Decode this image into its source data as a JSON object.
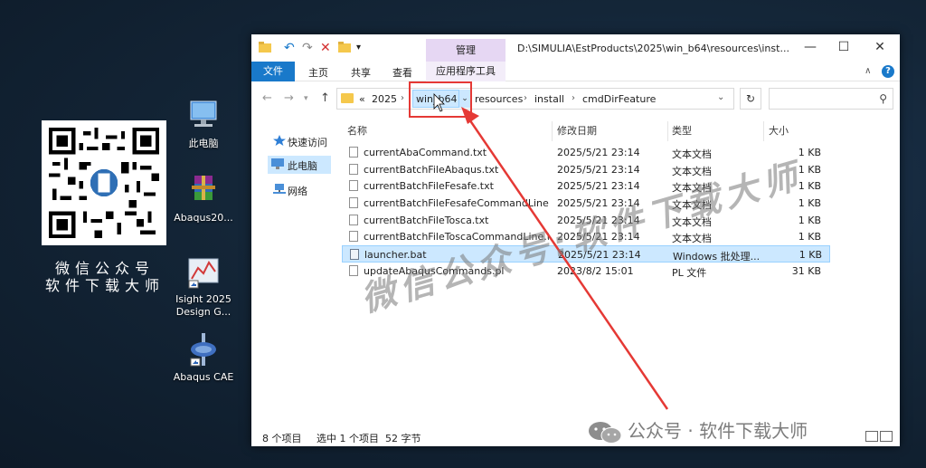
{
  "desktop": {
    "qr_caption_line1": "微信公众号",
    "qr_caption_line2": "软件下载大师",
    "icons": [
      {
        "label": "此电脑"
      },
      {
        "label": "Abaqus20..."
      },
      {
        "label": "Isight 2025 Design G..."
      },
      {
        "label": "Abaqus CAE"
      }
    ]
  },
  "window": {
    "title_path": "D:\\SIMULIA\\EstProducts\\2025\\win_b64\\resources\\inst...",
    "manage_tab": "管理",
    "ribbon_tabs": {
      "file": "文件",
      "home": "主页",
      "share": "共享",
      "view": "查看",
      "app_tools": "应用程序工具"
    },
    "address": {
      "overflow": "«",
      "segments": [
        "2025",
        "win_b64",
        "resources",
        "install",
        "cmdDirFeature"
      ]
    },
    "nav_pane": [
      "快速访问",
      "此电脑",
      "网络"
    ],
    "columns": {
      "name": "名称",
      "date": "修改日期",
      "type": "类型",
      "size": "大小"
    },
    "files": [
      {
        "name": "currentAbaCommand.txt",
        "date": "2025/5/21 23:14",
        "type": "文本文档",
        "size": "1 KB"
      },
      {
        "name": "currentBatchFileAbaqus.txt",
        "date": "2025/5/21 23:14",
        "type": "文本文档",
        "size": "1 KB"
      },
      {
        "name": "currentBatchFileFesafe.txt",
        "date": "2025/5/21 23:14",
        "type": "文本文档",
        "size": "1 KB"
      },
      {
        "name": "currentBatchFileFesafeCommandLine....",
        "date": "2025/5/21 23:14",
        "type": "文本文档",
        "size": "1 KB"
      },
      {
        "name": "currentBatchFileTosca.txt",
        "date": "2025/5/21 23:14",
        "type": "文本文档",
        "size": "1 KB"
      },
      {
        "name": "currentBatchFileToscaCommandLine.txt",
        "date": "2025/5/21 23:14",
        "type": "文本文档",
        "size": "1 KB"
      },
      {
        "name": "launcher.bat",
        "date": "2025/5/21 23:14",
        "type": "Windows 批处理...",
        "size": "1 KB"
      },
      {
        "name": "updateAbaqusCommands.pl",
        "date": "2023/8/2 15:01",
        "type": "PL 文件",
        "size": "31 KB"
      }
    ],
    "status": {
      "count": "8 个项目",
      "selected": "选中 1 个项目",
      "bytes": "52 字节"
    }
  },
  "watermark": {
    "diagonal": "微信公众号:软件下载大师",
    "bottom": "公众号 · 软件下载大师"
  },
  "colors": {
    "accent": "#1979ca",
    "selection": "#cce8ff",
    "highlight_box": "#e53935"
  }
}
